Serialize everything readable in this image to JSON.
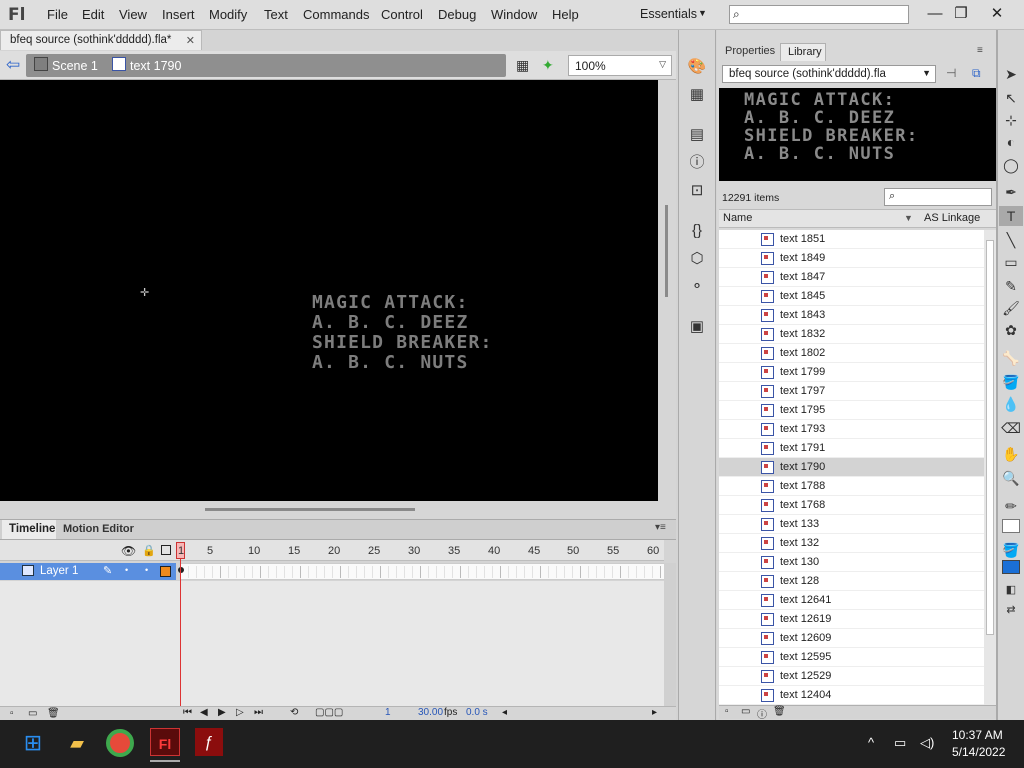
{
  "app": {
    "logo": "Fl"
  },
  "menu": [
    "File",
    "Edit",
    "View",
    "Insert",
    "Modify",
    "Text",
    "Commands",
    "Control",
    "Debug",
    "Window",
    "Help"
  ],
  "workspace": "Essentials",
  "document": {
    "tab_title": "bfeq source (sothink'ddddd).fla*"
  },
  "editbar": {
    "scene": "Scene 1",
    "symbol": "text 1790",
    "zoom": "100%"
  },
  "stage": {
    "text": "MAGIC ATTACK:\nA. B. C. DEEZ\nSHIELD BREAKER:\nA. B. C. NUTS"
  },
  "timeline": {
    "tabs": [
      "Timeline",
      "Motion Editor"
    ],
    "frame_numbers": [
      "1",
      "5",
      "10",
      "15",
      "20",
      "25",
      "30",
      "35",
      "40",
      "45",
      "50",
      "55",
      "60"
    ],
    "layer_name": "Layer 1",
    "status": {
      "frame": "1",
      "fps": "30.00",
      "fps_unit": "fps",
      "time": "0.0 s"
    }
  },
  "library": {
    "tabs": [
      "Properties",
      "Library"
    ],
    "file": "bfeq source (sothink'ddddd).fla",
    "preview_text": "MAGIC ATTACK:\nA. B. C. DEEZ\nSHIELD BREAKER:\nA. B. C. NUTS",
    "item_count": "12291 items",
    "columns": {
      "name": "Name",
      "linkage": "AS Linkage"
    },
    "items": [
      "text 1851",
      "text 1849",
      "text 1847",
      "text 1845",
      "text 1843",
      "text 1832",
      "text 1802",
      "text 1799",
      "text 1797",
      "text 1795",
      "text 1793",
      "text 1791",
      "text 1790",
      "text 1788",
      "text 1768",
      "text 133",
      "text 132",
      "text 130",
      "text 128",
      "text 12641",
      "text 12619",
      "text 12609",
      "text 12595",
      "text 12529",
      "text 12404"
    ],
    "selected_index": 12
  },
  "taskbar": {
    "time": "10:37 AM",
    "date": "5/14/2022"
  },
  "colors": {
    "layer_highlight": "#5a8fe0",
    "playhead": "#dd3333",
    "fill_color": "#1a6fd6"
  }
}
